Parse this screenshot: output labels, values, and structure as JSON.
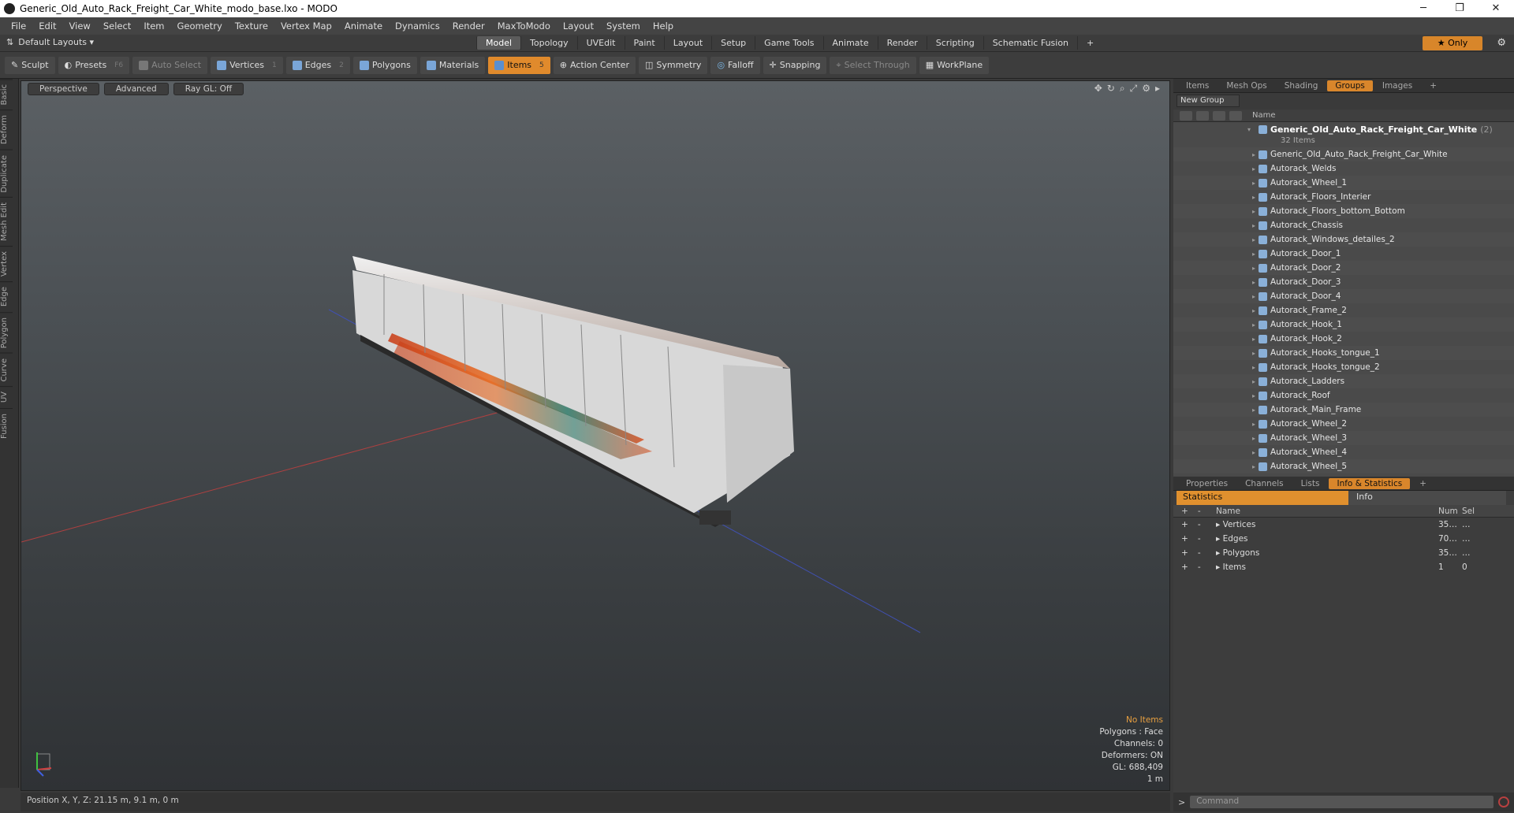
{
  "window": {
    "title": "Generic_Old_Auto_Rack_Freight_Car_White_modo_base.lxo - MODO",
    "minimize": "─",
    "maximize": "❐",
    "close": "✕"
  },
  "menu": [
    "File",
    "Edit",
    "View",
    "Select",
    "Item",
    "Geometry",
    "Texture",
    "Vertex Map",
    "Animate",
    "Dynamics",
    "Render",
    "MaxToModo",
    "Layout",
    "System",
    "Help"
  ],
  "layout": {
    "selector": "Default Layouts ▾",
    "tabs": [
      "Model",
      "Topology",
      "UVEdit",
      "Paint",
      "Layout",
      "Setup",
      "Game Tools",
      "Animate",
      "Render",
      "Scripting",
      "Schematic Fusion"
    ],
    "active_tab": "Model",
    "add": "+",
    "only": "★ Only"
  },
  "toolbar": {
    "sculpt": "Sculpt",
    "presets": "Presets",
    "presets_key": "F6",
    "auto_select": "Auto Select",
    "vertices": "Vertices",
    "vertices_key": "1",
    "edges": "Edges",
    "edges_key": "2",
    "polygons": "Polygons",
    "materials": "Materials",
    "items": "Items",
    "items_key": "5",
    "action_center": "Action Center",
    "symmetry": "Symmetry",
    "falloff": "Falloff",
    "snapping": "Snapping",
    "select_through": "Select Through",
    "workplane": "WorkPlane"
  },
  "side_tabs": [
    "Basic",
    "Deform",
    "Duplicate",
    "Mesh Edit",
    "Vertex",
    "Edge",
    "Polygon",
    "Curve",
    "UV",
    "Fusion"
  ],
  "viewport": {
    "view": "Perspective",
    "shading": "Advanced",
    "raygl": "Ray GL: Off",
    "stats": {
      "selection": "No Items",
      "polygons": "Polygons : Face",
      "channels": "Channels: 0",
      "deformers": "Deformers: ON",
      "gl": "GL: 688,409",
      "scale": "1 m"
    }
  },
  "status": {
    "position": "Position X, Y, Z:  21.15 m, 9.1 m, 0 m"
  },
  "items_panel": {
    "tabs": [
      "Items",
      "Mesh Ops",
      "Shading",
      "Groups",
      "Images"
    ],
    "active_tab": "Groups",
    "new_group": "New Group",
    "column_name": "Name",
    "root": {
      "name": "Generic_Old_Auto_Rack_Freight_Car_White",
      "count": "(2)",
      "sub": "32 Items"
    },
    "children": [
      "Generic_Old_Auto_Rack_Freight_Car_White",
      "Autorack_Welds",
      "Autorack_Wheel_1",
      "Autorack_Floors_Interier",
      "Autorack_Floors_bottom_Bottom",
      "Autorack_Chassis",
      "Autorack_Windows_detailes_2",
      "Autorack_Door_1",
      "Autorack_Door_2",
      "Autorack_Door_3",
      "Autorack_Door_4",
      "Autorack_Frame_2",
      "Autorack_Hook_1",
      "Autorack_Hook_2",
      "Autorack_Hooks_tongue_1",
      "Autorack_Hooks_tongue_2",
      "Autorack_Ladders",
      "Autorack_Roof",
      "Autorack_Main_Frame",
      "Autorack_Wheel_2",
      "Autorack_Wheel_3",
      "Autorack_Wheel_4",
      "Autorack_Wheel_5"
    ]
  },
  "info_panel": {
    "tabs": [
      "Properties",
      "Channels",
      "Lists",
      "Info & Statistics"
    ],
    "active_tab": "Info & Statistics",
    "statistics": "Statistics",
    "info": "Info",
    "columns": {
      "name": "Name",
      "num": "Num",
      "sel": "Sel"
    },
    "rows": [
      {
        "name": "Vertices",
        "num": "35…",
        "sel": "…"
      },
      {
        "name": "Edges",
        "num": "70…",
        "sel": "…"
      },
      {
        "name": "Polygons",
        "num": "35…",
        "sel": "…"
      },
      {
        "name": "Items",
        "num": "1",
        "sel": "0"
      }
    ]
  },
  "command": {
    "placeholder": "Command"
  }
}
